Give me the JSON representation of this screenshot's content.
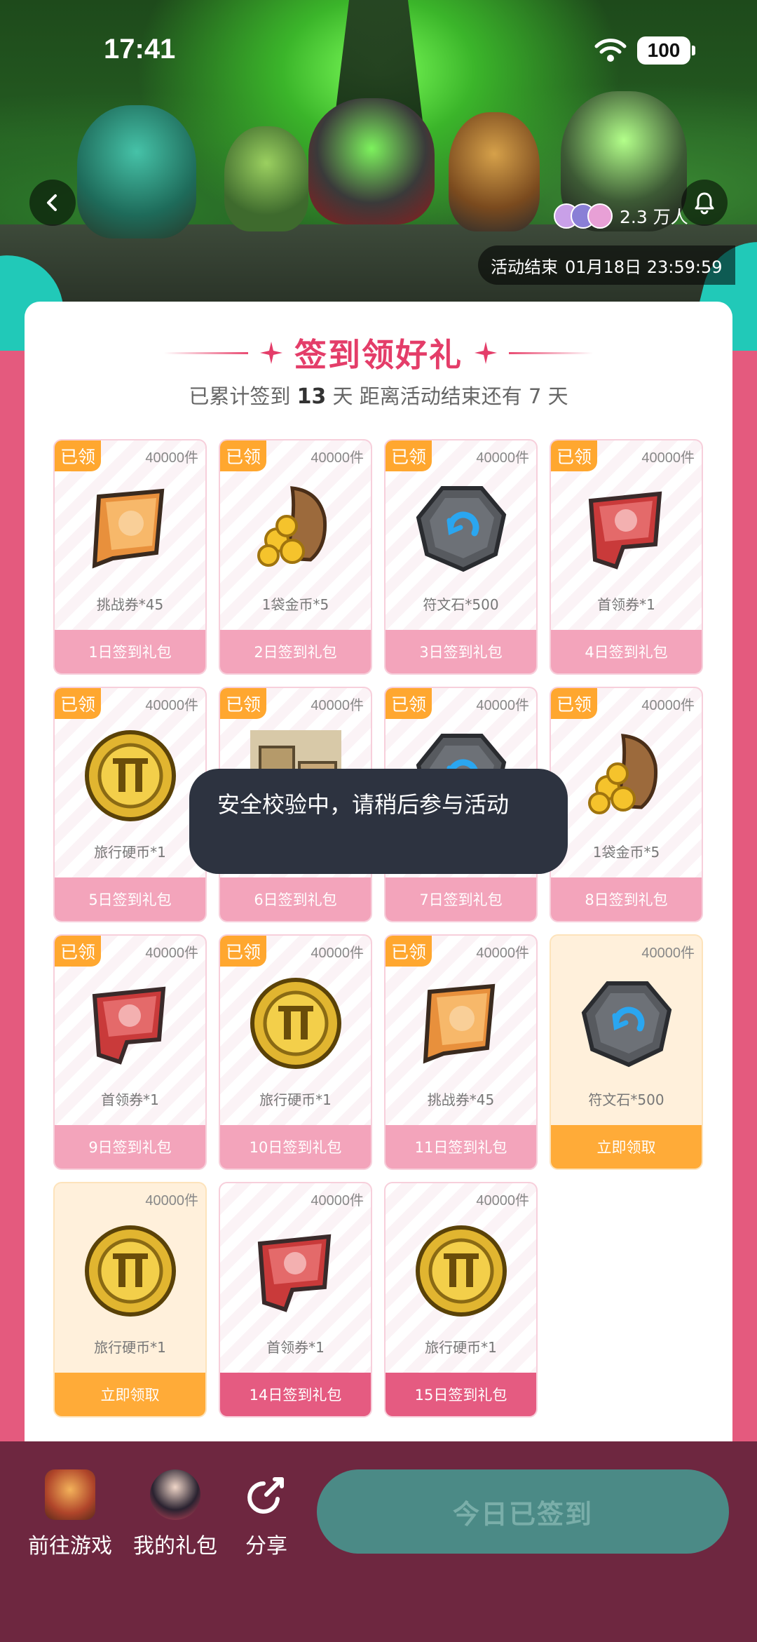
{
  "status_bar": {
    "time": "17:41",
    "battery": "100"
  },
  "hero": {
    "participants": "2.3 万人",
    "end_label": "活动结束",
    "end_time": "01月18日 23:59:59"
  },
  "header": {
    "title": "签到领好礼",
    "subtitle_prefix": "已累计签到",
    "signed_days": "13",
    "subtitle_mid": "天  距离活动结束还有",
    "remaining_days": "7",
    "subtitle_suffix": "天"
  },
  "claimed_tag": "已领",
  "gifts": [
    {
      "stock": "40000件",
      "name": "挑战券*45",
      "footer": "1日签到礼包",
      "state": "claimed",
      "icon": "ticket-orange-icon"
    },
    {
      "stock": "40000件",
      "name": "1袋金币*5",
      "footer": "2日签到礼包",
      "state": "claimed",
      "icon": "coin-bag-icon"
    },
    {
      "stock": "40000件",
      "name": "符文石*500",
      "footer": "3日签到礼包",
      "state": "claimed",
      "icon": "rune-stone-icon"
    },
    {
      "stock": "40000件",
      "name": "首领券*1",
      "footer": "4日签到礼包",
      "state": "claimed",
      "icon": "ticket-red-icon"
    },
    {
      "stock": "40000件",
      "name": "旅行硬币*1",
      "footer": "5日签到礼包",
      "state": "claimed",
      "icon": "travel-coin-icon"
    },
    {
      "stock": "40000件",
      "name": "",
      "footer": "6日签到礼包",
      "state": "claimed",
      "icon": "item-box-icon"
    },
    {
      "stock": "40000件",
      "name": "",
      "footer": "7日签到礼包",
      "state": "claimed",
      "icon": "rune-stone-icon"
    },
    {
      "stock": "40000件",
      "name": "1袋金币*5",
      "footer": "8日签到礼包",
      "state": "claimed",
      "icon": "coin-bag-icon"
    },
    {
      "stock": "40000件",
      "name": "首领券*1",
      "footer": "9日签到礼包",
      "state": "claimed",
      "icon": "ticket-red-icon"
    },
    {
      "stock": "40000件",
      "name": "旅行硬币*1",
      "footer": "10日签到礼包",
      "state": "claimed",
      "icon": "travel-coin-icon"
    },
    {
      "stock": "40000件",
      "name": "挑战券*45",
      "footer": "11日签到礼包",
      "state": "claimed",
      "icon": "ticket-orange-icon"
    },
    {
      "stock": "40000件",
      "name": "符文石*500",
      "footer": "立即领取",
      "state": "claimable",
      "icon": "rune-stone-icon"
    },
    {
      "stock": "40000件",
      "name": "旅行硬币*1",
      "footer": "立即领取",
      "state": "claimable",
      "icon": "travel-coin-icon"
    },
    {
      "stock": "40000件",
      "name": "首领券*1",
      "footer": "14日签到礼包",
      "state": "future",
      "icon": "ticket-red-icon"
    },
    {
      "stock": "40000件",
      "name": "旅行硬币*1",
      "footer": "15日签到礼包",
      "state": "future",
      "icon": "travel-coin-icon"
    }
  ],
  "toast": "安全校验中，请稍后参与活动",
  "bottom": {
    "go_game": "前往游戏",
    "my_gifts": "我的礼包",
    "share": "分享",
    "signed_button": "今日已签到"
  },
  "colors": {
    "accent_pink": "#e43d69",
    "claimed_orange": "#ffa72f",
    "bottom_bar": "#6e2740",
    "signed_button": "#4b8a86"
  }
}
